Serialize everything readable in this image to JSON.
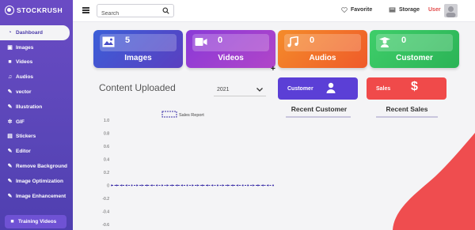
{
  "brand": {
    "name": "STOCKRUSH"
  },
  "sidebar": {
    "items": [
      {
        "label": "Dashboard",
        "icon": "dashboard-icon",
        "active": true
      },
      {
        "label": "Images",
        "icon": "image-icon"
      },
      {
        "label": "Videos",
        "icon": "video-icon"
      },
      {
        "label": "Audios",
        "icon": "music-icon"
      },
      {
        "label": "vector",
        "icon": "vector-icon"
      },
      {
        "label": "Illustration",
        "icon": "edit-icon"
      },
      {
        "label": "GIF",
        "icon": "gear-icon"
      },
      {
        "label": "Stickers",
        "icon": "sticker-icon"
      },
      {
        "label": "Editor",
        "icon": "edit-icon"
      },
      {
        "label": "Remove Background",
        "icon": "edit-icon"
      },
      {
        "label": "Image Optimization",
        "icon": "edit-icon"
      },
      {
        "label": "Image Enhancement",
        "icon": "edit-icon"
      }
    ],
    "training": "Training Videos"
  },
  "header": {
    "search_placeholder": "Search",
    "favorite": "Favorite",
    "storage": "Storage",
    "user": "User"
  },
  "cards": [
    {
      "count": "5",
      "label": "Images",
      "icon": "image-icon",
      "color": "#4a4fc8"
    },
    {
      "count": "0",
      "label": "Videos",
      "icon": "video-camera-icon",
      "color": "#9b3fd1"
    },
    {
      "count": "0",
      "label": "Audios",
      "icon": "music-icon",
      "color": "#f26b2a"
    },
    {
      "count": "0",
      "label": "Customer",
      "icon": "graduate-icon",
      "color": "#33c161"
    }
  ],
  "content": {
    "title": "Content Uploaded",
    "year": "2021"
  },
  "panels": {
    "customer_label": "Customer",
    "sales_label": "Sales",
    "recent_customer": "Recent Customer",
    "recent_sales": "Recent Sales"
  },
  "chart_data": {
    "type": "line",
    "title": "",
    "legend": [
      "Sales Report"
    ],
    "series": [
      {
        "name": "Sales Report",
        "values": [
          0,
          0,
          0,
          0,
          0,
          0,
          0,
          0,
          0,
          0,
          0,
          0,
          0,
          0,
          0,
          0,
          0,
          0,
          0,
          0,
          0,
          0,
          0,
          0,
          0,
          0,
          0,
          0,
          0,
          0,
          0,
          0,
          0
        ]
      }
    ],
    "yticks": [
      "1.0",
      "0.8",
      "0.6",
      "0.4",
      "0.2",
      "0",
      "-0.2",
      "-0.4",
      "-0.6"
    ],
    "ylim": [
      -0.6,
      1.0
    ],
    "xlabel": "",
    "ylabel": "",
    "grid": false,
    "line_color": "#3b2fa8"
  },
  "colors": {
    "sidebar": "#5a46b8",
    "customer_panel": "#5b3fd6",
    "sales_panel": "#f04a4a",
    "user_text": "#e24a4a"
  }
}
